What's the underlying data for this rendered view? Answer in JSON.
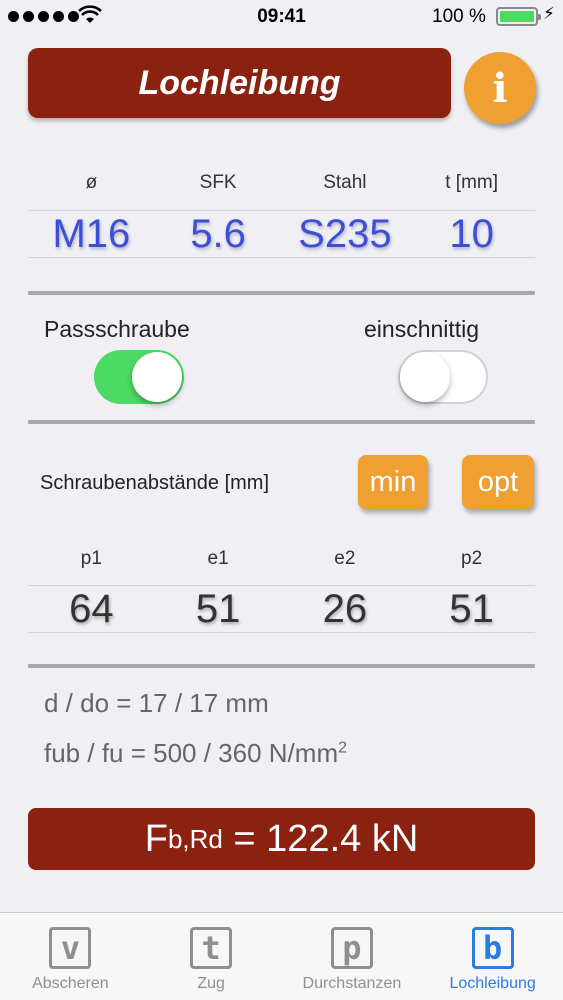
{
  "status_bar": {
    "time": "09:41",
    "battery": "100 %"
  },
  "header": {
    "title": "Lochleibung",
    "info_icon": "i"
  },
  "bolt_params": {
    "headers": [
      "ø",
      "SFK",
      "Stahl",
      "t [mm]"
    ],
    "values": [
      "M16",
      "5.6",
      "S235",
      "10"
    ]
  },
  "toggles": {
    "passschraube": {
      "label": "Passschraube",
      "on": true
    },
    "einschnittig": {
      "label": "einschnittig",
      "on": false
    }
  },
  "spacing": {
    "label": "Schraubenabstände [mm]",
    "min_label": "min",
    "opt_label": "opt",
    "headers": [
      "p1",
      "e1",
      "e2",
      "p2"
    ],
    "values": [
      "64",
      "51",
      "26",
      "51"
    ]
  },
  "info": {
    "d_do": "d / do = 17 / 17 mm",
    "fub_fu": "fub / fu = 500 / 360 N/mm",
    "fub_fu_sup": "2"
  },
  "result": {
    "symbol": "F",
    "subscript": "b,Rd",
    "value": " = 122.4 kN"
  },
  "tabs": [
    {
      "icon": "v",
      "label": "Abscheren"
    },
    {
      "icon": "t",
      "label": "Zug"
    },
    {
      "icon": "p",
      "label": "Durchstanzen"
    },
    {
      "icon": "b",
      "label": "Lochleibung"
    }
  ],
  "colors": {
    "brand_red": "#8b2210",
    "accent_orange": "#f0a030",
    "value_blue": "#3c4fd6",
    "toggle_green": "#4cd964",
    "tab_active": "#2a7de1"
  }
}
